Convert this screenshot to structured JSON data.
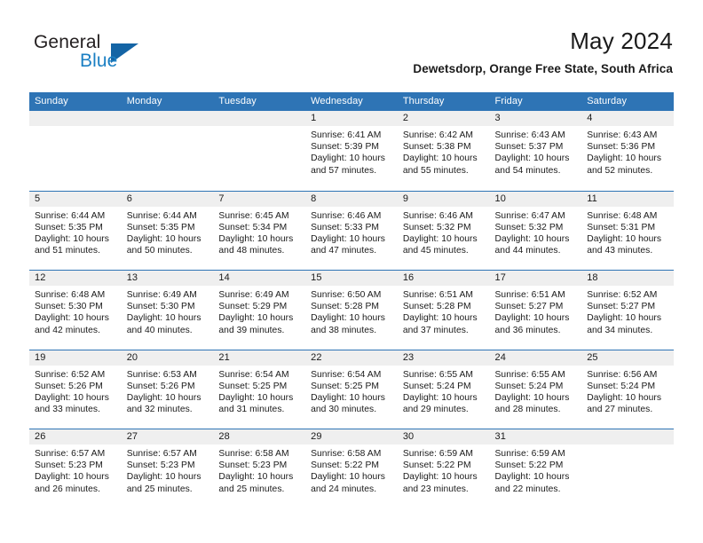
{
  "brand": {
    "word_one": "General",
    "word_two": "Blue",
    "triangle_icon": "brand-triangle-icon",
    "color_dark": "#231f20",
    "color_blue": "#1b7fc3",
    "color_triangle": "#1464a5"
  },
  "header": {
    "month_title": "May 2024",
    "location": "Dewetsdorp, Orange Free State, South Africa"
  },
  "theme": {
    "header_blue": "#2e74b5",
    "day_band_gray": "#efefef",
    "text": "#1a1a1a",
    "page_background": "#ffffff"
  },
  "weekdays": [
    "Sunday",
    "Monday",
    "Tuesday",
    "Wednesday",
    "Thursday",
    "Friday",
    "Saturday"
  ],
  "labels": {
    "sunrise_prefix": "Sunrise:",
    "sunset_prefix": "Sunset:",
    "daylight_prefix": "Daylight:"
  },
  "weeks": [
    [
      {
        "day": "",
        "empty": true
      },
      {
        "day": "",
        "empty": true
      },
      {
        "day": "",
        "empty": true
      },
      {
        "day": "1",
        "sunrise": "Sunrise: 6:41 AM",
        "sunset": "Sunset: 5:39 PM",
        "daylight_line1": "Daylight: 10 hours",
        "daylight_line2": "and 57 minutes."
      },
      {
        "day": "2",
        "sunrise": "Sunrise: 6:42 AM",
        "sunset": "Sunset: 5:38 PM",
        "daylight_line1": "Daylight: 10 hours",
        "daylight_line2": "and 55 minutes."
      },
      {
        "day": "3",
        "sunrise": "Sunrise: 6:43 AM",
        "sunset": "Sunset: 5:37 PM",
        "daylight_line1": "Daylight: 10 hours",
        "daylight_line2": "and 54 minutes."
      },
      {
        "day": "4",
        "sunrise": "Sunrise: 6:43 AM",
        "sunset": "Sunset: 5:36 PM",
        "daylight_line1": "Daylight: 10 hours",
        "daylight_line2": "and 52 minutes."
      }
    ],
    [
      {
        "day": "5",
        "sunrise": "Sunrise: 6:44 AM",
        "sunset": "Sunset: 5:35 PM",
        "daylight_line1": "Daylight: 10 hours",
        "daylight_line2": "and 51 minutes."
      },
      {
        "day": "6",
        "sunrise": "Sunrise: 6:44 AM",
        "sunset": "Sunset: 5:35 PM",
        "daylight_line1": "Daylight: 10 hours",
        "daylight_line2": "and 50 minutes."
      },
      {
        "day": "7",
        "sunrise": "Sunrise: 6:45 AM",
        "sunset": "Sunset: 5:34 PM",
        "daylight_line1": "Daylight: 10 hours",
        "daylight_line2": "and 48 minutes."
      },
      {
        "day": "8",
        "sunrise": "Sunrise: 6:46 AM",
        "sunset": "Sunset: 5:33 PM",
        "daylight_line1": "Daylight: 10 hours",
        "daylight_line2": "and 47 minutes."
      },
      {
        "day": "9",
        "sunrise": "Sunrise: 6:46 AM",
        "sunset": "Sunset: 5:32 PM",
        "daylight_line1": "Daylight: 10 hours",
        "daylight_line2": "and 45 minutes."
      },
      {
        "day": "10",
        "sunrise": "Sunrise: 6:47 AM",
        "sunset": "Sunset: 5:32 PM",
        "daylight_line1": "Daylight: 10 hours",
        "daylight_line2": "and 44 minutes."
      },
      {
        "day": "11",
        "sunrise": "Sunrise: 6:48 AM",
        "sunset": "Sunset: 5:31 PM",
        "daylight_line1": "Daylight: 10 hours",
        "daylight_line2": "and 43 minutes."
      }
    ],
    [
      {
        "day": "12",
        "sunrise": "Sunrise: 6:48 AM",
        "sunset": "Sunset: 5:30 PM",
        "daylight_line1": "Daylight: 10 hours",
        "daylight_line2": "and 42 minutes."
      },
      {
        "day": "13",
        "sunrise": "Sunrise: 6:49 AM",
        "sunset": "Sunset: 5:30 PM",
        "daylight_line1": "Daylight: 10 hours",
        "daylight_line2": "and 40 minutes."
      },
      {
        "day": "14",
        "sunrise": "Sunrise: 6:49 AM",
        "sunset": "Sunset: 5:29 PM",
        "daylight_line1": "Daylight: 10 hours",
        "daylight_line2": "and 39 minutes."
      },
      {
        "day": "15",
        "sunrise": "Sunrise: 6:50 AM",
        "sunset": "Sunset: 5:28 PM",
        "daylight_line1": "Daylight: 10 hours",
        "daylight_line2": "and 38 minutes."
      },
      {
        "day": "16",
        "sunrise": "Sunrise: 6:51 AM",
        "sunset": "Sunset: 5:28 PM",
        "daylight_line1": "Daylight: 10 hours",
        "daylight_line2": "and 37 minutes."
      },
      {
        "day": "17",
        "sunrise": "Sunrise: 6:51 AM",
        "sunset": "Sunset: 5:27 PM",
        "daylight_line1": "Daylight: 10 hours",
        "daylight_line2": "and 36 minutes."
      },
      {
        "day": "18",
        "sunrise": "Sunrise: 6:52 AM",
        "sunset": "Sunset: 5:27 PM",
        "daylight_line1": "Daylight: 10 hours",
        "daylight_line2": "and 34 minutes."
      }
    ],
    [
      {
        "day": "19",
        "sunrise": "Sunrise: 6:52 AM",
        "sunset": "Sunset: 5:26 PM",
        "daylight_line1": "Daylight: 10 hours",
        "daylight_line2": "and 33 minutes."
      },
      {
        "day": "20",
        "sunrise": "Sunrise: 6:53 AM",
        "sunset": "Sunset: 5:26 PM",
        "daylight_line1": "Daylight: 10 hours",
        "daylight_line2": "and 32 minutes."
      },
      {
        "day": "21",
        "sunrise": "Sunrise: 6:54 AM",
        "sunset": "Sunset: 5:25 PM",
        "daylight_line1": "Daylight: 10 hours",
        "daylight_line2": "and 31 minutes."
      },
      {
        "day": "22",
        "sunrise": "Sunrise: 6:54 AM",
        "sunset": "Sunset: 5:25 PM",
        "daylight_line1": "Daylight: 10 hours",
        "daylight_line2": "and 30 minutes."
      },
      {
        "day": "23",
        "sunrise": "Sunrise: 6:55 AM",
        "sunset": "Sunset: 5:24 PM",
        "daylight_line1": "Daylight: 10 hours",
        "daylight_line2": "and 29 minutes."
      },
      {
        "day": "24",
        "sunrise": "Sunrise: 6:55 AM",
        "sunset": "Sunset: 5:24 PM",
        "daylight_line1": "Daylight: 10 hours",
        "daylight_line2": "and 28 minutes."
      },
      {
        "day": "25",
        "sunrise": "Sunrise: 6:56 AM",
        "sunset": "Sunset: 5:24 PM",
        "daylight_line1": "Daylight: 10 hours",
        "daylight_line2": "and 27 minutes."
      }
    ],
    [
      {
        "day": "26",
        "sunrise": "Sunrise: 6:57 AM",
        "sunset": "Sunset: 5:23 PM",
        "daylight_line1": "Daylight: 10 hours",
        "daylight_line2": "and 26 minutes."
      },
      {
        "day": "27",
        "sunrise": "Sunrise: 6:57 AM",
        "sunset": "Sunset: 5:23 PM",
        "daylight_line1": "Daylight: 10 hours",
        "daylight_line2": "and 25 minutes."
      },
      {
        "day": "28",
        "sunrise": "Sunrise: 6:58 AM",
        "sunset": "Sunset: 5:23 PM",
        "daylight_line1": "Daylight: 10 hours",
        "daylight_line2": "and 25 minutes."
      },
      {
        "day": "29",
        "sunrise": "Sunrise: 6:58 AM",
        "sunset": "Sunset: 5:22 PM",
        "daylight_line1": "Daylight: 10 hours",
        "daylight_line2": "and 24 minutes."
      },
      {
        "day": "30",
        "sunrise": "Sunrise: 6:59 AM",
        "sunset": "Sunset: 5:22 PM",
        "daylight_line1": "Daylight: 10 hours",
        "daylight_line2": "and 23 minutes."
      },
      {
        "day": "31",
        "sunrise": "Sunrise: 6:59 AM",
        "sunset": "Sunset: 5:22 PM",
        "daylight_line1": "Daylight: 10 hours",
        "daylight_line2": "and 22 minutes."
      },
      {
        "day": "",
        "empty": true
      }
    ]
  ]
}
